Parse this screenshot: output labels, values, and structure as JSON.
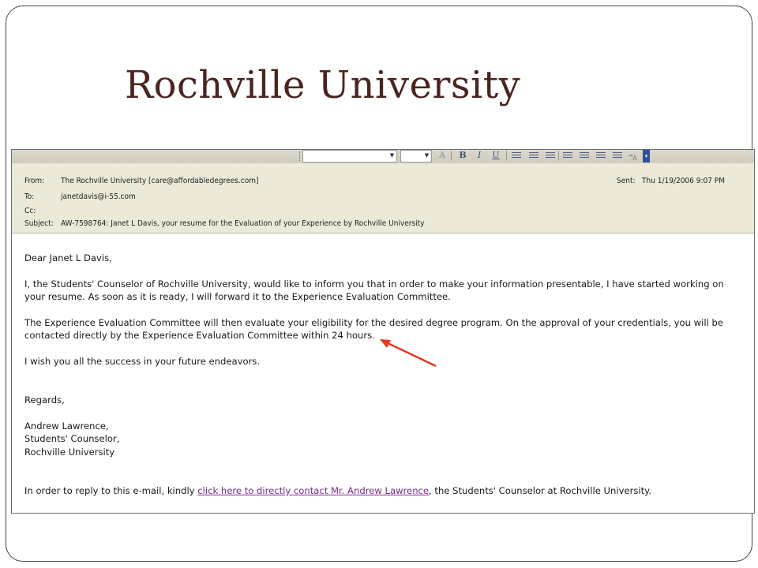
{
  "slide": {
    "title": "Rochville University"
  },
  "toolbar": {
    "font_name": "",
    "font_size": "",
    "bold_label": "B",
    "italic_label": "I",
    "underline_label": "U",
    "icons": [
      "bold-icon",
      "italic-icon",
      "underline-icon",
      "align-left-icon",
      "align-center-icon",
      "align-right-icon",
      "numbered-list-icon",
      "bullet-list-icon",
      "decrease-indent-icon",
      "increase-indent-icon",
      "line-icon",
      "font-color-icon",
      "toolbar-options-icon"
    ]
  },
  "email": {
    "from_label": "From:",
    "from_value": "The Rochville University [care@affordabledegrees.com]",
    "sent_label": "Sent:",
    "sent_value": "Thu 1/19/2006 9:07 PM",
    "to_label": "To:",
    "to_value": "janetdavis@i-55.com",
    "cc_label": "Cc:",
    "cc_value": "",
    "subject_label": "Subject:",
    "subject_value": "AW-7598764: Janet L Davis, your resume for the Evaluation of your Experience by Rochville University",
    "greeting": "Dear Janet L Davis,",
    "para1_line1": "I, the Students' Counselor of Rochville University, would like to inform you that in order to make your information presentable, I have started working on",
    "para1_line2": "your resume. As soon as it is ready, I will forward it to the Experience Evaluation Committee.",
    "para2_line1": "The Experience Evaluation Committee will then evaluate your eligibility for the desired degree program. On the approval of your credentials, you will be",
    "para2_line2": "contacted directly by the Experience Evaluation Committee within 24 hours.",
    "para3": "I wish you all the success in your future endeavors.",
    "closing": "Regards,",
    "sig_name": "Andrew Lawrence,",
    "sig_title": "Students' Counselor,",
    "sig_org": "Rochville University",
    "footer_prefix": "In order to reply to this e-mail, kindly ",
    "footer_link": "click here to directly contact Mr. Andrew Lawrence",
    "footer_suffix": ", the Students' Counselor at Rochville University."
  },
  "annotation": {
    "arrow_color": "#e03a1e"
  }
}
